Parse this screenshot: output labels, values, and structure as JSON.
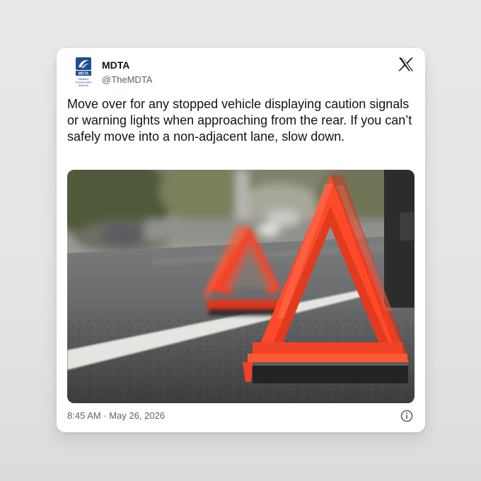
{
  "tweet": {
    "display_name": "MDTA",
    "handle": "@TheMDTA",
    "text": "Move over for any stopped vehicle displaying caution signals or warning lights when approaching from the rear. If you can’t safely move into a non-adjacent lane, slow down.",
    "time": "8:45 AM",
    "separator": "·",
    "date": "May 26, 2026"
  },
  "avatar": {
    "logo_text": "MDTA",
    "caption": [
      "Maryland",
      "Transportation",
      "Authority"
    ],
    "icon": "mdta-logo"
  },
  "icons": {
    "platform": "x-logo-icon",
    "info": "info-icon"
  },
  "colors": {
    "text_primary": "#0f1419",
    "text_secondary": "#536471",
    "triangle_red": "#f0442a",
    "mdta_blue": "#1f4e8c"
  }
}
